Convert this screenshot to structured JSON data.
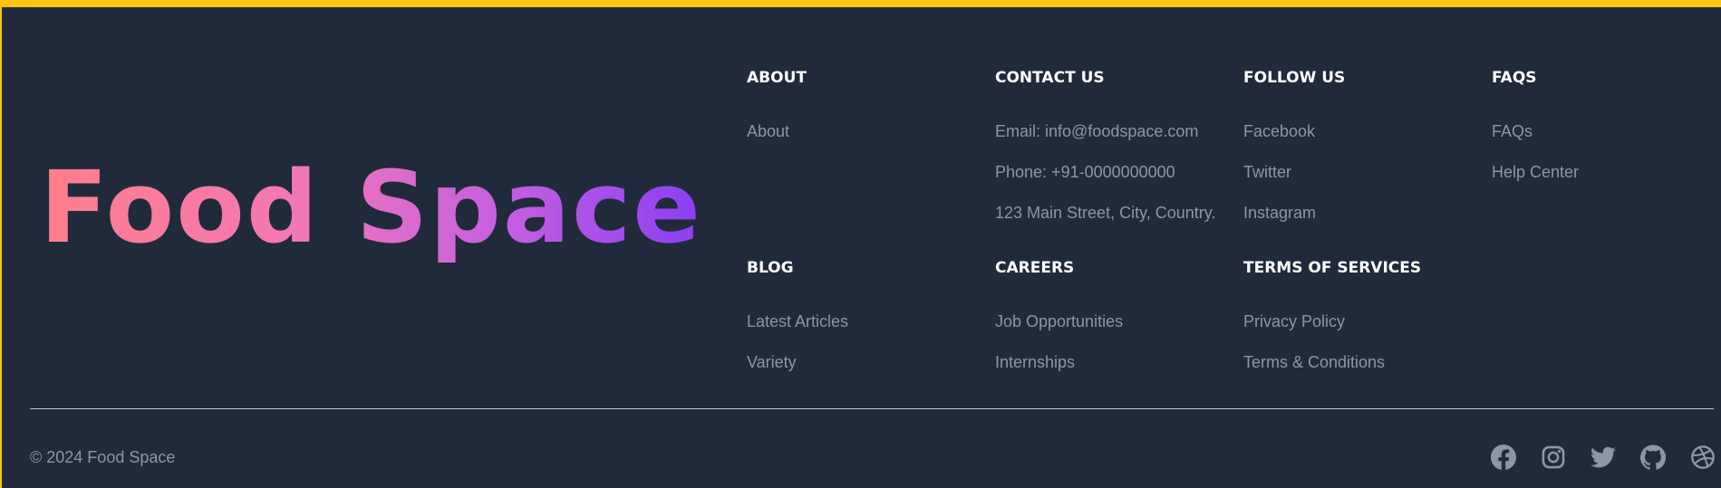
{
  "brand": {
    "logo_text": "Food Space",
    "gradient_colors": [
      "#ff7f8a",
      "#f277b7",
      "#c45fe0",
      "#8a3ff3"
    ]
  },
  "theme": {
    "background": "#212a3b",
    "accent_border": "#fac514",
    "link_color": "#8d96a5",
    "heading_color": "#ffffff"
  },
  "columns": {
    "about": {
      "heading": "ABOUT",
      "links": [
        "About"
      ]
    },
    "contact": {
      "heading": "CONTACT US",
      "links": [
        "Email: info@foodspace.com",
        "Phone: +91-0000000000",
        "123 Main Street, City, Country."
      ]
    },
    "follow": {
      "heading": "FOLLOW US",
      "links": [
        "Facebook",
        "Twitter",
        "Instagram"
      ]
    },
    "faqs": {
      "heading": "FAQS",
      "links": [
        "FAQs",
        "Help Center"
      ]
    },
    "blog": {
      "heading": "BLOG",
      "links": [
        "Latest Articles",
        "Variety"
      ]
    },
    "careers": {
      "heading": "CAREERS",
      "links": [
        "Job Opportunities",
        "Internships"
      ]
    },
    "terms": {
      "heading": "TERMS OF SERVICES",
      "links": [
        "Privacy Policy",
        "Terms & Conditions"
      ]
    }
  },
  "bottom": {
    "copyright": "© 2024 Food Space",
    "social_icons": [
      "facebook-icon",
      "instagram-icon",
      "twitter-icon",
      "github-icon",
      "dribbble-icon"
    ]
  }
}
